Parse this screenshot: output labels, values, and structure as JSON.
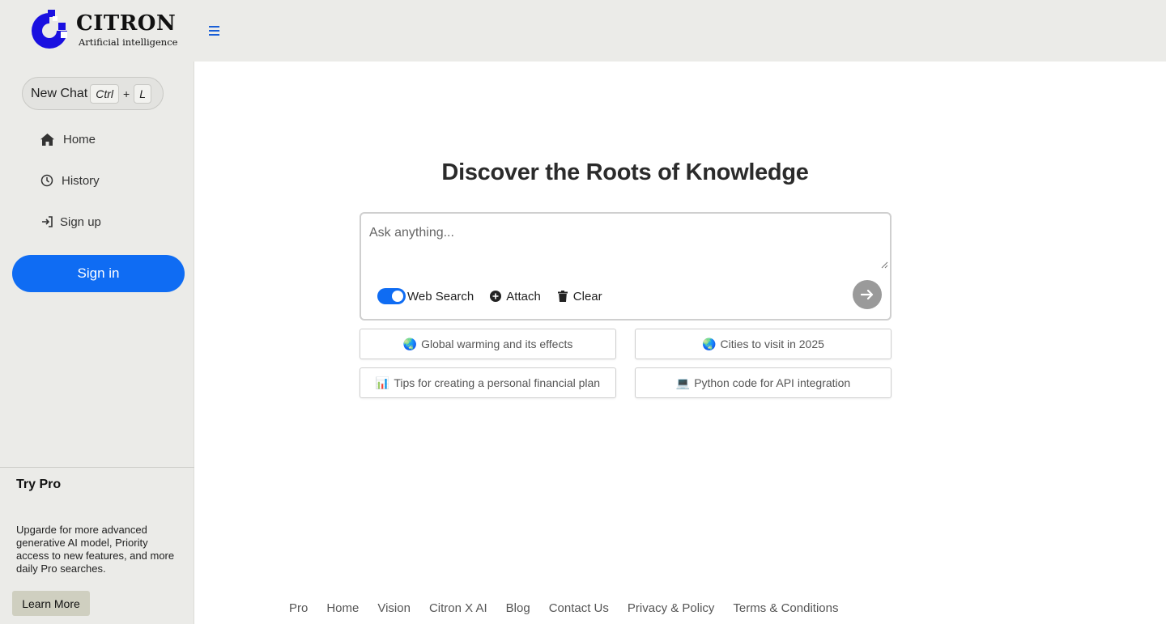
{
  "brand": {
    "name": "CITRON",
    "tagline": "Artificial intelligence",
    "accent": "#1a10e0"
  },
  "sidebar": {
    "new_chat": {
      "label": "New Chat",
      "key1": "Ctrl",
      "plus": "+",
      "key2": "L"
    },
    "items": [
      {
        "label": "Home",
        "icon": "home-icon"
      },
      {
        "label": "History",
        "icon": "clock-icon"
      },
      {
        "label": "Sign up",
        "icon": "sign-in-arrow-icon"
      }
    ],
    "sign_in_label": "Sign in",
    "pro": {
      "title": "Try Pro",
      "text": "Upgarde for more advanced generative AI model, Priority access to new features, and more daily Pro searches.",
      "button": "Learn More"
    }
  },
  "main": {
    "headline": "Discover the Roots of Knowledge",
    "search": {
      "placeholder": "Ask anything...",
      "web_search_label": "Web Search",
      "web_search_on": true,
      "attach_label": "Attach",
      "clear_label": "Clear"
    },
    "suggestions": [
      {
        "emoji": "🌏",
        "text": "Global warming and its effects"
      },
      {
        "emoji": "🌏",
        "text": "Cities to visit in 2025"
      },
      {
        "emoji": "📊",
        "text": "Tips for creating a personal financial plan"
      },
      {
        "emoji": "💻",
        "text": "Python code for API integration"
      }
    ]
  },
  "footer": {
    "links": [
      "Pro",
      "Home",
      "Vision",
      "Citron X AI",
      "Blog",
      "Contact Us",
      "Privacy & Policy",
      "Terms & Conditions"
    ]
  },
  "colors": {
    "primary": "#0f6cf3",
    "sidebar_bg": "#ebebe8",
    "send_btn": "#9a9a9a"
  }
}
